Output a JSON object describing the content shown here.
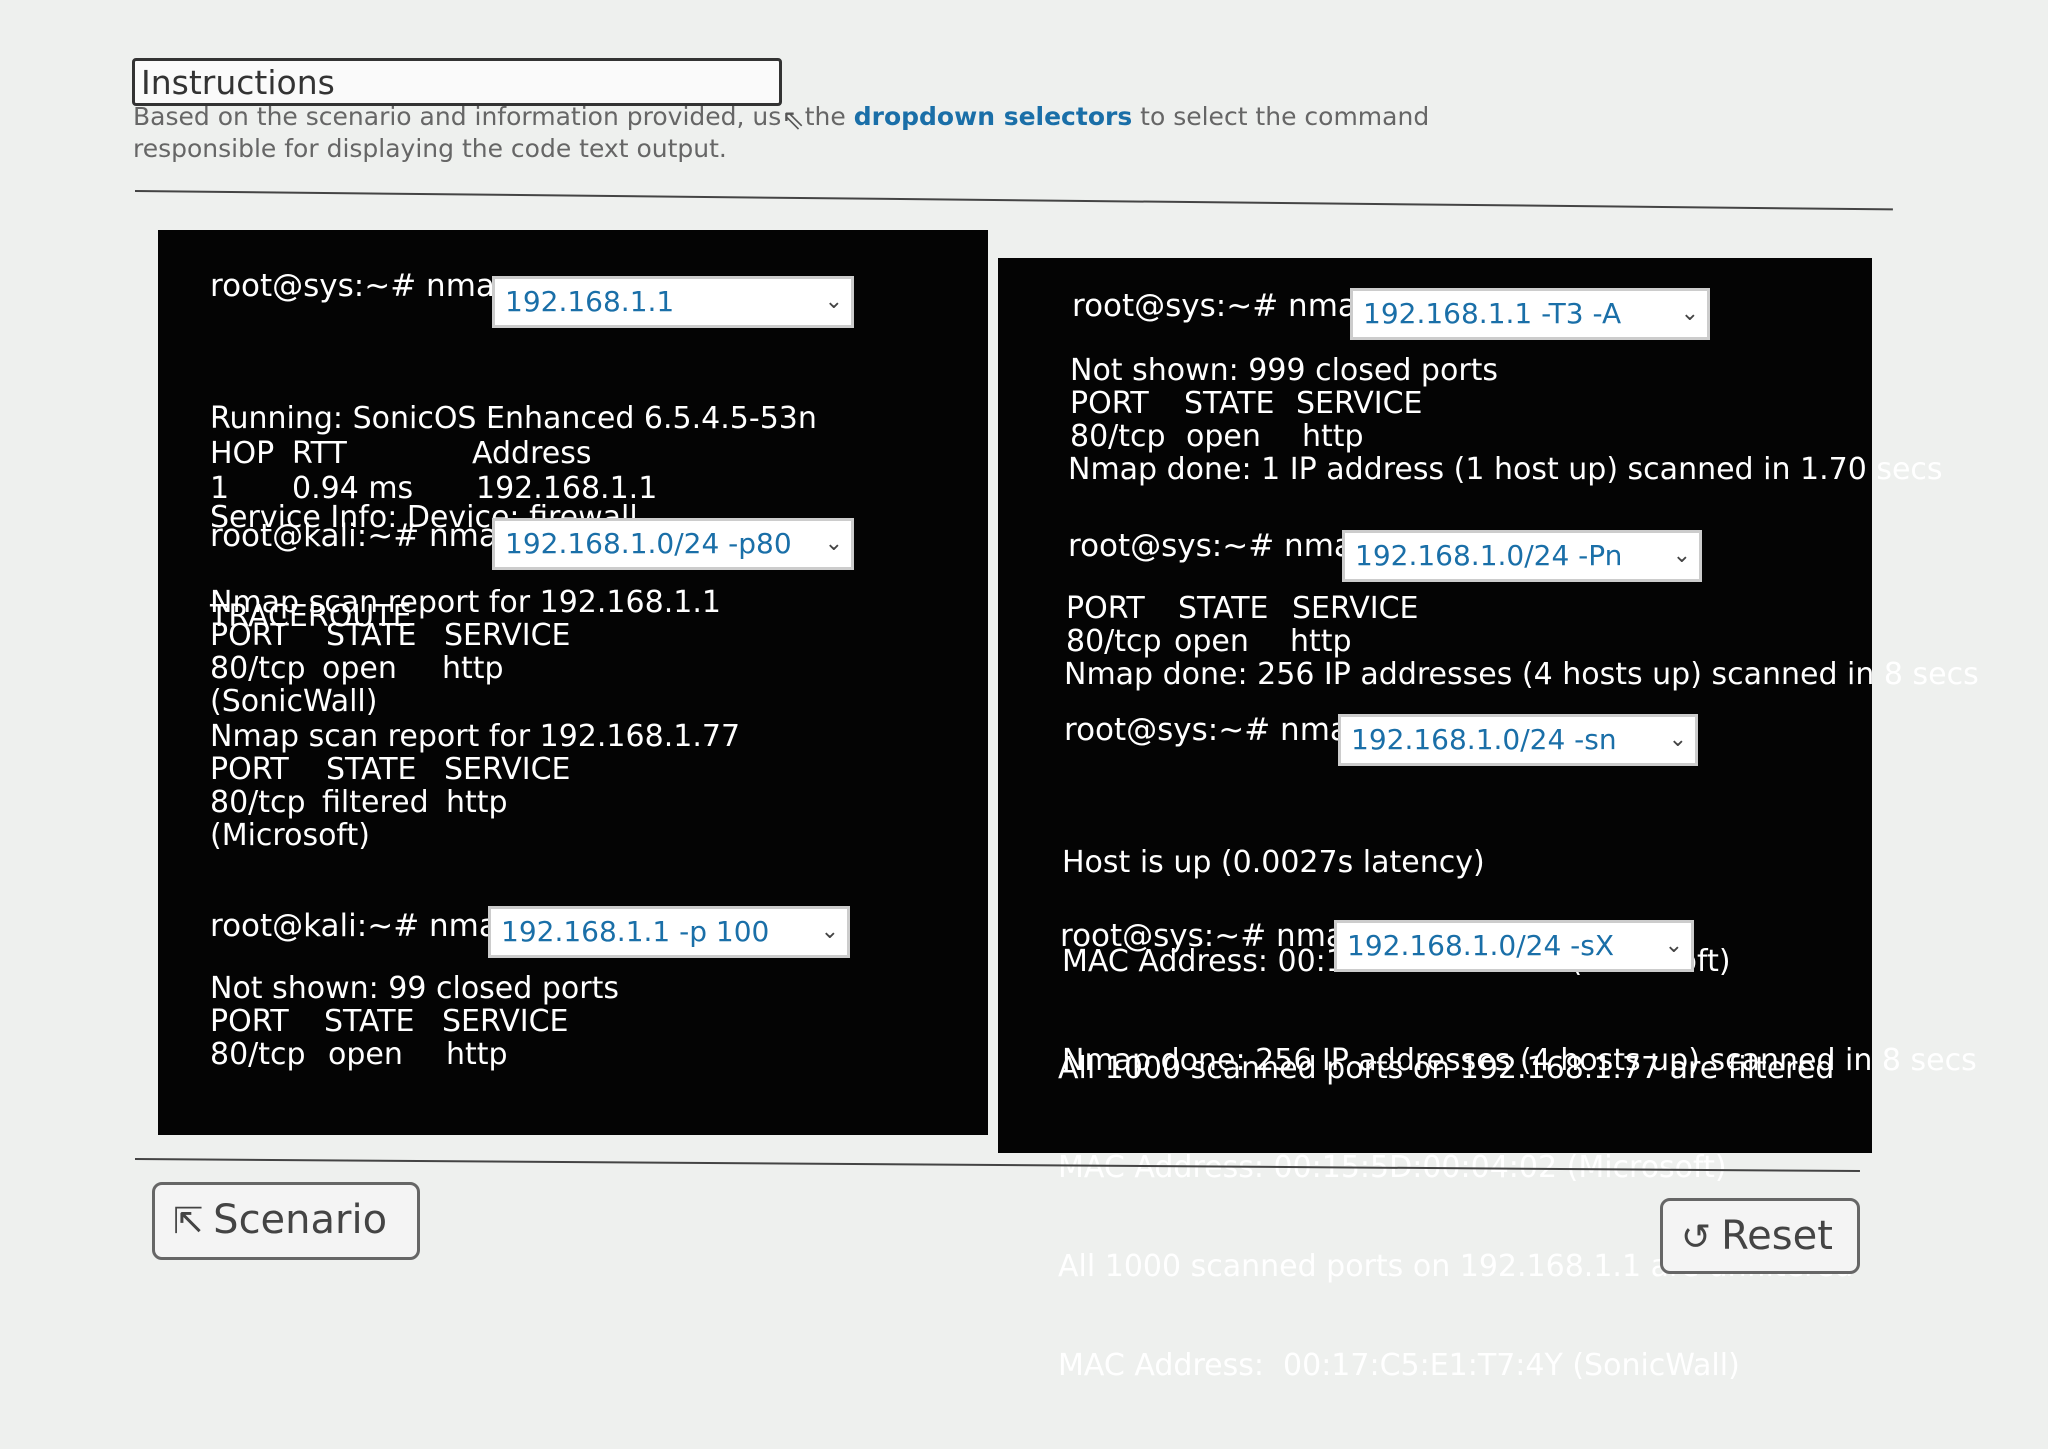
{
  "instructions": {
    "title": "Instructions",
    "text_before": "Based on the scenario and information provided, us",
    "text_mid": "the ",
    "highlight": "dropdown selectors",
    "text_after": " to select the command responsible for displaying the code text output."
  },
  "left_panel": {
    "block1": {
      "prompt": "root@sys:~# nmap",
      "select_value": "192.168.1.1",
      "lines": [
        "Running: SonicOS Enhanced 6.5.4.5-53n",
        "Service Info: Device: firewall",
        "TRACEROUTE"
      ],
      "trace_header": [
        "HOP",
        "RTT",
        "Address"
      ],
      "trace_row": [
        "1",
        "0.94 ms",
        "192.168.1.1"
      ]
    },
    "block2": {
      "prompt": "root@kali:~# nmap",
      "select_value": "192.168.1.0/24 -p80",
      "report1": "Nmap scan report for 192.168.1.1",
      "header1": [
        "PORT",
        "STATE",
        "SERVICE"
      ],
      "row1": [
        "80/tcp",
        "open",
        "http"
      ],
      "vendor1": "(SonicWall)",
      "report2": "Nmap scan report for 192.168.1.77",
      "header2": [
        "PORT",
        "STATE",
        "SERVICE"
      ],
      "row2": [
        "80/tcp",
        "filtered",
        "http"
      ],
      "vendor2": "(Microsoft)"
    },
    "block3": {
      "prompt": "root@kali:~# nmap",
      "select_value": "192.168.1.1 -p 100",
      "line1": "Not shown: 99 closed ports",
      "header": [
        "PORT",
        "STATE",
        "SERVICE"
      ],
      "row": [
        "80/tcp",
        "open",
        "http"
      ]
    }
  },
  "right_panel": {
    "block1": {
      "prompt": "root@sys:~# nmap",
      "select_value": "192.168.1.1 -T3 -A",
      "line1": "Not shown: 999 closed ports",
      "header": [
        "PORT",
        "STATE",
        "SERVICE"
      ],
      "row": [
        "80/tcp",
        "open",
        "http"
      ],
      "done": "Nmap done: 1 IP address (1 host up) scanned in 1.70 secs"
    },
    "block2": {
      "prompt": "root@sys:~# nmap",
      "select_value": "192.168.1.0/24 -Pn",
      "header": [
        "PORT",
        "STATE",
        "SERVICE"
      ],
      "row": [
        "80/tcp",
        "open",
        "http"
      ],
      "done": "Nmap done: 256 IP addresses (4 hosts up) scanned in 8 secs"
    },
    "block3": {
      "prompt": "root@sys:~# nmap",
      "select_value": "192.168.1.0/24 -sn",
      "lines": [
        "Host is up (0.0027s latency)",
        "MAC Address: 00:15:5D:00:04:02 (Microsoft)",
        "Nmap done: 256 IP addresses (4 hosts up) scanned in 8 secs"
      ]
    },
    "block4": {
      "prompt": "root@sys:~# nmap",
      "select_value": "192.168.1.0/24 -sX",
      "lines": [
        "All 1000 scanned ports on 192.168.1.77 are filtered",
        "MAC Address: 00:15:5D:00:04:02 (Microsoft)",
        "All 1000 scanned ports on 192.168.1.1 are unfiltered",
        "MAC Address:  00:17:C5:E1:T7:4Y (SonicWall)"
      ]
    }
  },
  "buttons": {
    "scenario": "Scenario",
    "reset": "Reset"
  },
  "icons": {
    "scenario": "export-icon",
    "reset": "reset-icon",
    "cursor": "mouse-cursor-icon",
    "dropdown": "chevron-down-icon"
  },
  "colors": {
    "panel": "#040404",
    "highlight": "#1a6fa8",
    "select_text": "#1a6fa8"
  }
}
